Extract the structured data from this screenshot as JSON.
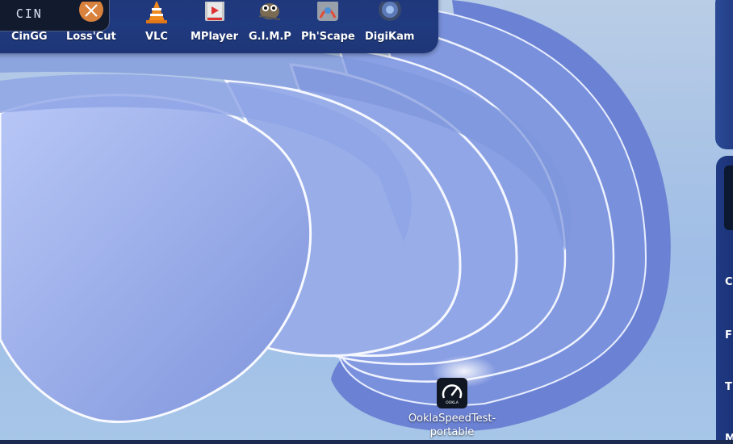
{
  "dock": {
    "items": [
      {
        "label": "CinGG",
        "icon": "cin-icon",
        "icon_text": "CIN"
      },
      {
        "label": "Loss'Cut",
        "icon": "scissors-icon"
      },
      {
        "label": "VLC",
        "icon": "traffic-cone-icon"
      },
      {
        "label": "MPlayer",
        "icon": "media-player-icon"
      },
      {
        "label": "G.I.M.P",
        "icon": "gimp-mascot-icon"
      },
      {
        "label": "Ph'Scape",
        "icon": "photoscape-icon"
      },
      {
        "label": "DigiKam",
        "icon": "lens-icon"
      }
    ]
  },
  "right_panel": {
    "letters": [
      "C",
      "F",
      "T",
      "M"
    ]
  },
  "desktop": {
    "shortcut": {
      "label_line1": "OoklaSpeedTest-",
      "label_line2": "portable",
      "icon": "speedometer-icon",
      "icon_text": "OOKLA"
    }
  },
  "colors": {
    "dock_bg": "#203a80",
    "wallpaper_blue": "#7f9be0",
    "label_text": "#ffffff"
  }
}
